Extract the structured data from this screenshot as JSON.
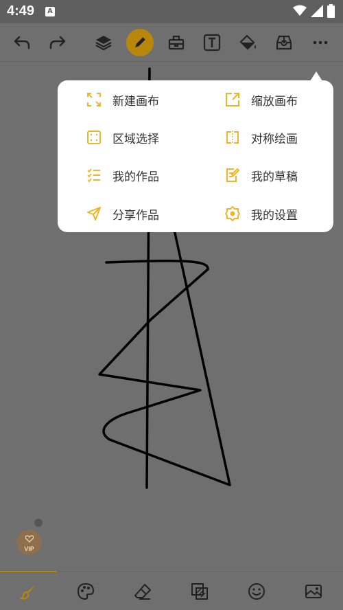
{
  "status_bar": {
    "time": "4:49",
    "app_icon_letter": "A",
    "icons": [
      "wifi-icon",
      "signal-icon",
      "battery-icon"
    ]
  },
  "toolbar": {
    "items": [
      "undo-icon",
      "redo-icon",
      "layers-icon",
      "pencil-icon",
      "toolbox-icon",
      "text-icon",
      "fill-bucket-icon",
      "import-icon",
      "more-icon"
    ],
    "active_item": "pencil-icon",
    "accent_color": "#b8860b"
  },
  "menu": {
    "items": [
      {
        "label": "新建画布",
        "icon": "new-canvas-icon"
      },
      {
        "label": "缩放画布",
        "icon": "resize-canvas-icon"
      },
      {
        "label": "区域选择",
        "icon": "area-select-icon"
      },
      {
        "label": "对称绘画",
        "icon": "symmetry-draw-icon"
      },
      {
        "label": "我的作品",
        "icon": "my-works-icon"
      },
      {
        "label": "我的草稿",
        "icon": "my-drafts-icon"
      },
      {
        "label": "分享作品",
        "icon": "share-works-icon"
      },
      {
        "label": "我的设置",
        "icon": "settings-icon"
      }
    ],
    "icon_color": "#f0b429"
  },
  "vip_badge": {
    "label": "VIP"
  },
  "bottom_nav": {
    "items": [
      "brush-icon",
      "palette-icon",
      "eraser-icon",
      "layers-stack-icon",
      "emoji-icon",
      "image-icon"
    ],
    "active_item": "brush-icon"
  }
}
